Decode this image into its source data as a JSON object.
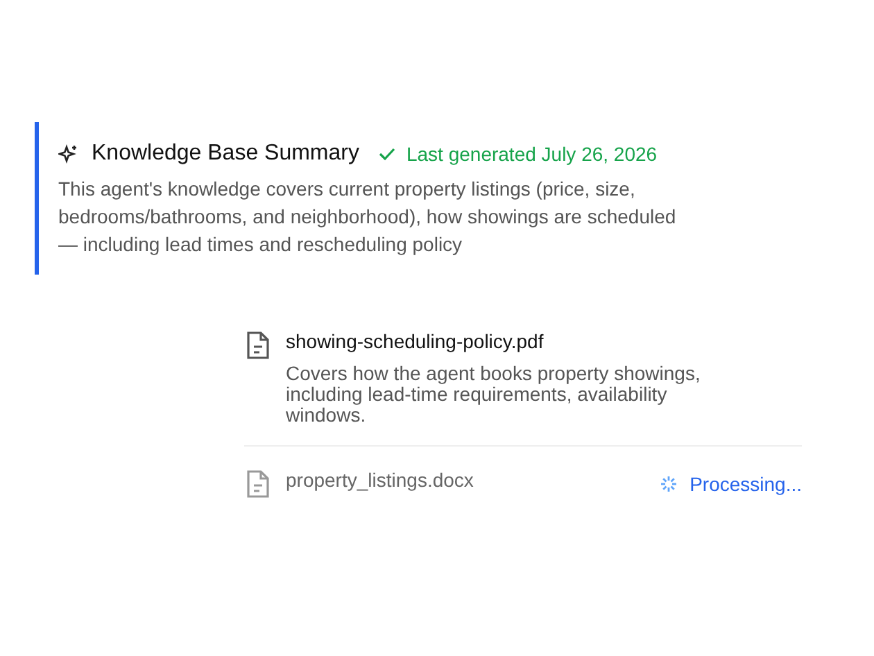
{
  "summary": {
    "title": "Knowledge Base Summary",
    "status": "Last generated July 26, 2026",
    "text": "This agent's knowledge covers current property listings (price, size, bedrooms/bathrooms, and neighborhood), how showings are scheduled — including lead times and rescheduling policy"
  },
  "files": [
    {
      "name": "showing-scheduling-policy.pdf",
      "kind": "ready",
      "description": "Covers how the agent books property showings, including lead-time requirements, availability windows."
    },
    {
      "name": "property_listings.docx",
      "kind": "processing",
      "status": "Processing..."
    }
  ]
}
